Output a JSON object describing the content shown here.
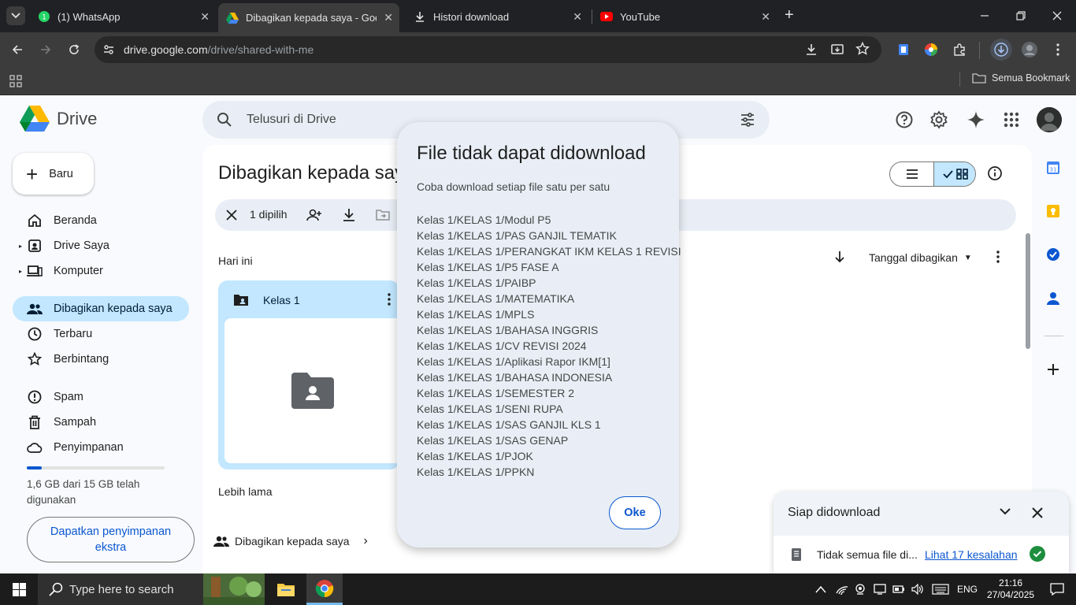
{
  "browser": {
    "tabs": [
      {
        "title": "(1) WhatsApp",
        "icon": "whatsapp-icon"
      },
      {
        "title": "Dibagikan kepada saya - Google Drive",
        "icon": "drive-icon"
      },
      {
        "title": "Histori download",
        "icon": "download-icon"
      },
      {
        "title": "YouTube",
        "icon": "youtube-icon"
      }
    ],
    "url_host": "drive.google.com",
    "url_path": "/drive/shared-with-me",
    "bookmarks_label": "Semua Bookmark"
  },
  "drive": {
    "logo_text": "Drive",
    "search_placeholder": "Telusuri di Drive",
    "new_button": "Baru",
    "nav": [
      {
        "label": "Beranda",
        "icon": "home-icon"
      },
      {
        "label": "Drive Saya",
        "icon": "my-drive-icon"
      },
      {
        "label": "Komputer",
        "icon": "computer-icon"
      },
      {
        "label": "Dibagikan kepada saya",
        "icon": "shared-icon"
      },
      {
        "label": "Terbaru",
        "icon": "clock-icon"
      },
      {
        "label": "Berbintang",
        "icon": "star-icon"
      },
      {
        "label": "Spam",
        "icon": "spam-icon"
      },
      {
        "label": "Sampah",
        "icon": "trash-icon"
      },
      {
        "label": "Penyimpanan",
        "icon": "cloud-icon"
      }
    ],
    "storage_text": "1,6 GB dari 15 GB telah digunakan",
    "storage_used_fraction": 0.107,
    "get_storage_button": "Dapatkan penyimpanan ekstra",
    "page_title": "Dibagikan kepada saya",
    "selection_count": "1 dipilih",
    "section_today": "Hari ini",
    "section_older": "Lebih lama",
    "sort_label": "Tanggal dibagikan",
    "folder_name": "Kelas 1",
    "breadcrumb_root": "Dibagikan kepada saya"
  },
  "dialog": {
    "title": "File tidak dapat didownload",
    "subtitle": "Coba download setiap file satu per satu",
    "files": [
      "Kelas 1/KELAS 1/Modul P5",
      "Kelas 1/KELAS 1/PAS GANJIL TEMATIK",
      "Kelas 1/KELAS 1/PERANGKAT IKM KELAS 1 REVISI",
      "Kelas 1/KELAS 1/P5 FASE A",
      "Kelas 1/KELAS 1/PAIBP",
      "Kelas 1/KELAS 1/MATEMATIKA",
      "Kelas 1/KELAS 1/MPLS",
      "Kelas 1/KELAS 1/BAHASA INGGRIS",
      "Kelas 1/KELAS 1/CV REVISI 2024",
      "Kelas 1/KELAS 1/Aplikasi Rapor IKM[1]",
      "Kelas 1/KELAS 1/BAHASA INDONESIA",
      "Kelas 1/KELAS 1/SEMESTER 2",
      "Kelas 1/KELAS 1/SENI RUPA",
      "Kelas 1/KELAS 1/SAS GANJIL KLS 1",
      "Kelas 1/KELAS 1/SAS GENAP",
      "Kelas 1/KELAS 1/PJOK",
      "Kelas 1/KELAS 1/PPKN"
    ],
    "ok_button": "Oke"
  },
  "download_panel": {
    "title": "Siap didownload",
    "item_text": "Tidak semua file di...",
    "errors_link": "Lihat 17 kesalahan"
  },
  "taskbar": {
    "search_placeholder": "Type here to search",
    "language": "ENG",
    "time": "21:16",
    "date": "27/04/2025"
  },
  "colors": {
    "accent": "#0b57d0",
    "active_nav": "#c2e7ff",
    "dialog_bg": "#e9eef6"
  }
}
